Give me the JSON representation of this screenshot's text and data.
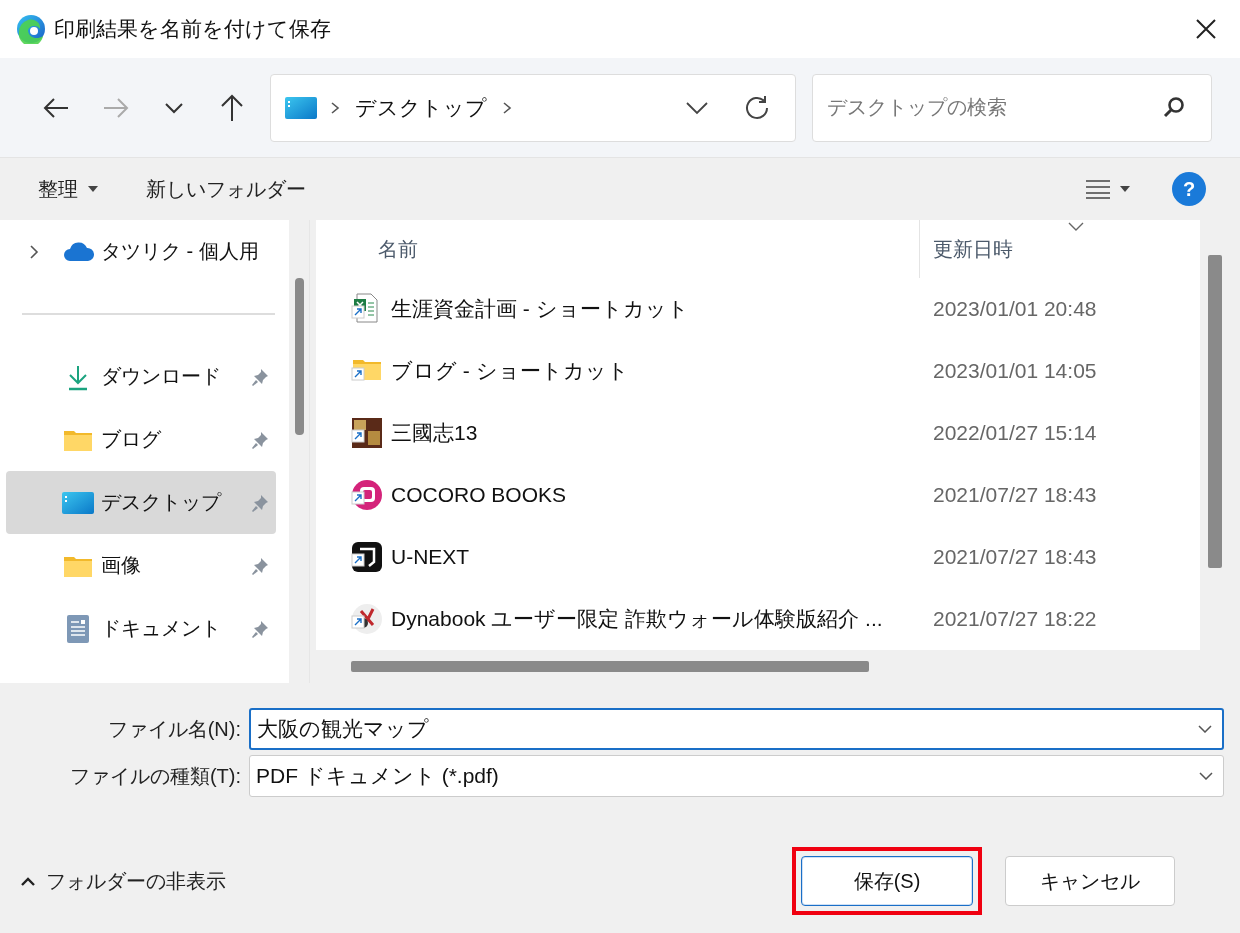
{
  "window": {
    "title": "印刷結果を名前を付けて保存"
  },
  "address_bar": {
    "path": [
      "デスクトップ"
    ]
  },
  "search": {
    "placeholder": "デスクトップの検索"
  },
  "toolbar": {
    "organize": "整理",
    "new_folder": "新しいフォルダー",
    "help": "?"
  },
  "sidebar": {
    "items": [
      {
        "label": "タツリク - 個人用",
        "kind": "cloud",
        "pinned": false,
        "selected": false
      },
      {
        "label": "ダウンロード",
        "kind": "download",
        "pinned": true,
        "selected": false
      },
      {
        "label": "ブログ",
        "kind": "folder",
        "pinned": true,
        "selected": false
      },
      {
        "label": "デスクトップ",
        "kind": "desktop",
        "pinned": true,
        "selected": true
      },
      {
        "label": "画像",
        "kind": "folder",
        "pinned": true,
        "selected": false
      },
      {
        "label": "ドキュメント",
        "kind": "document",
        "pinned": true,
        "selected": false
      }
    ]
  },
  "file_list": {
    "columns": [
      "名前",
      "更新日時"
    ],
    "rows": [
      {
        "name": "生涯資金計画 - ショートカット",
        "modified": "2023/01/01 20:48",
        "kind": "spreadsheet"
      },
      {
        "name": "ブログ - ショートカット",
        "modified": "2023/01/01 14:05",
        "kind": "folder"
      },
      {
        "name": "三國志13",
        "modified": "2022/01/27 15:14",
        "kind": "game"
      },
      {
        "name": "COCORO BOOKS",
        "modified": "2021/07/27 18:43",
        "kind": "reader"
      },
      {
        "name": "U-NEXT",
        "modified": "2021/07/27 18:43",
        "kind": "video"
      },
      {
        "name": "Dynabook ユーザー限定 詐欺ウォール体験版紹介 ...",
        "modified": "2021/07/27 18:22",
        "kind": "security"
      }
    ]
  },
  "file_name": {
    "label": "ファイル名(N):",
    "value": "大阪の観光マップ"
  },
  "file_type": {
    "label": "ファイルの種類(T):",
    "value": "PDF ドキュメント (*.pdf)"
  },
  "hide_folders": "フォルダーの非表示",
  "buttons": [
    {
      "label": "保存(S)",
      "highlighted": true
    },
    {
      "label": "キャンセル",
      "highlighted": false
    }
  ]
}
